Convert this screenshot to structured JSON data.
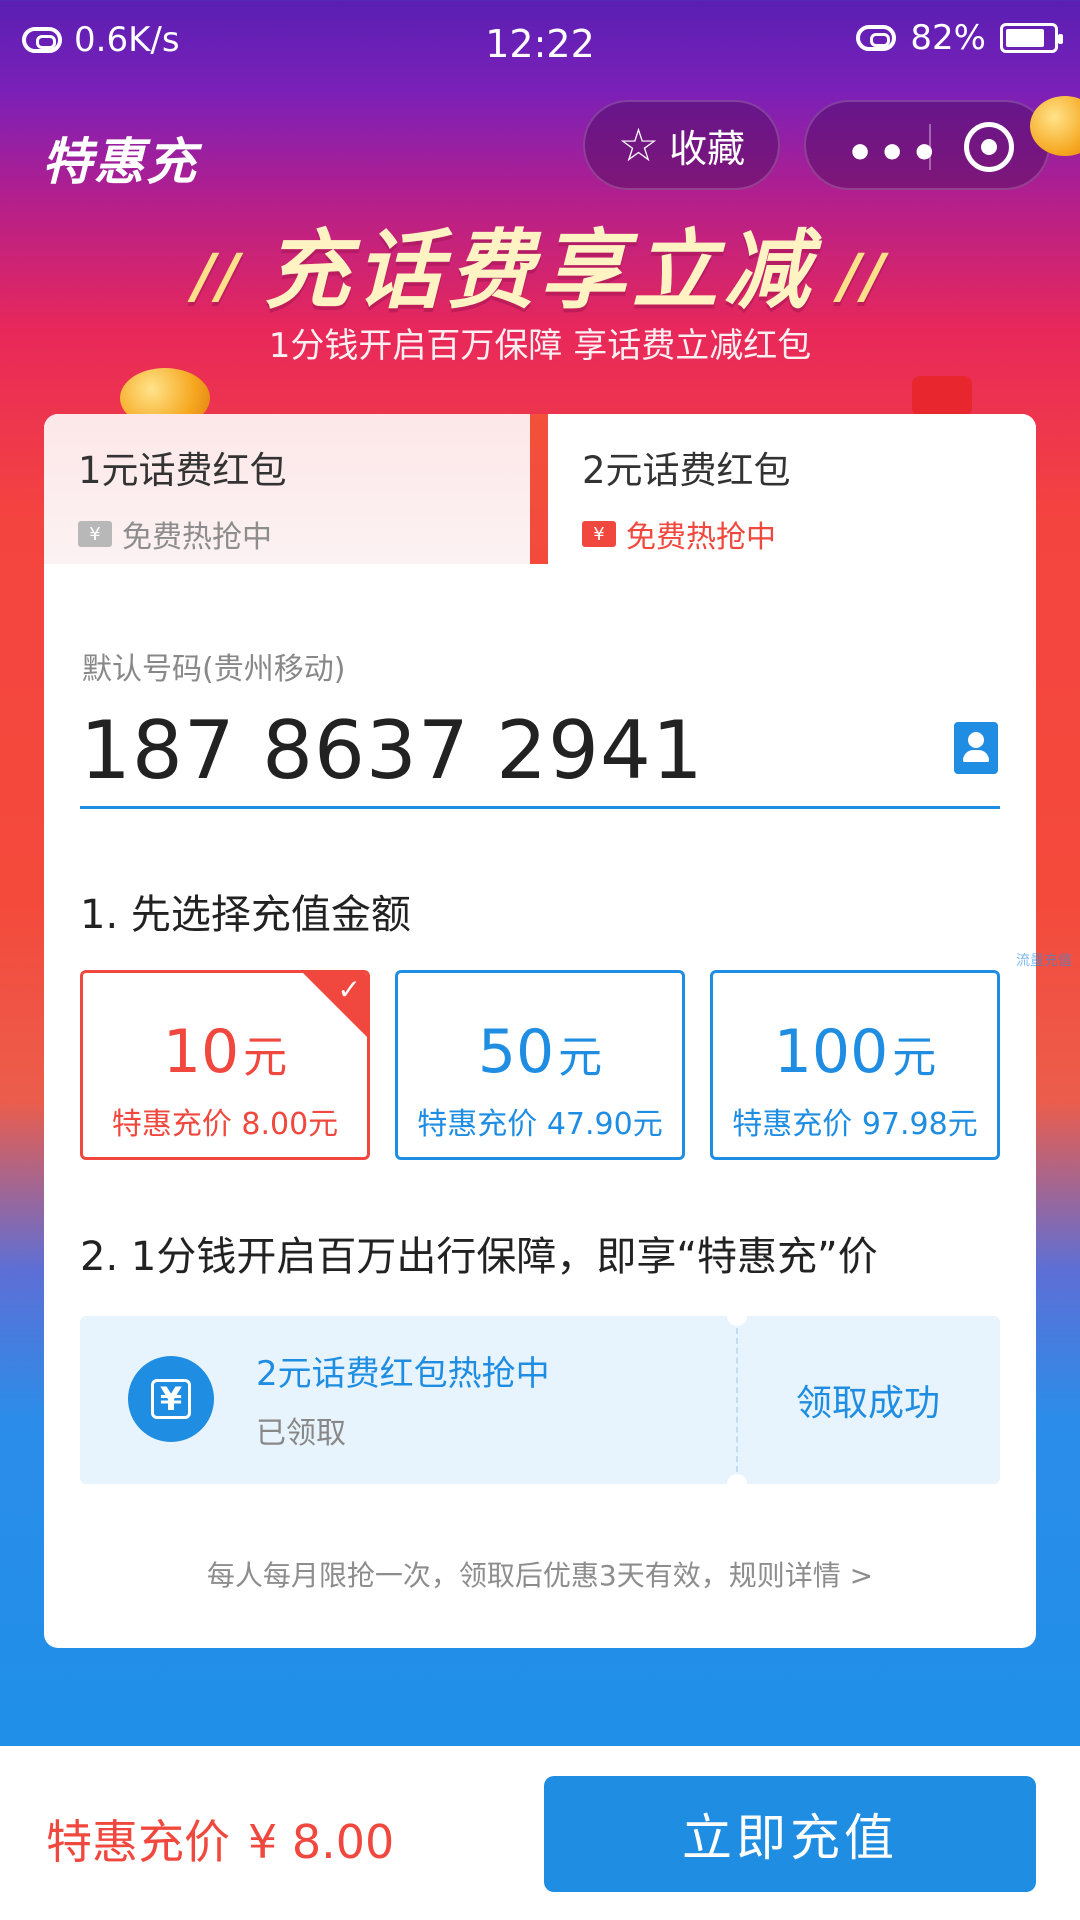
{
  "status_bar": {
    "speed": "0.6K/s",
    "time": "12:22",
    "battery": "82%"
  },
  "header": {
    "brand": "特惠充",
    "favorite_label": "收藏",
    "more_label": "•••"
  },
  "hero": {
    "title": "充话费享立减",
    "subtitle": "1分钱开启百万保障  享话费立减红包"
  },
  "tabs": [
    {
      "title": "1元话费红包",
      "subtitle": "免费热抢中"
    },
    {
      "title": "2元话费红包",
      "subtitle": "免费热抢中"
    }
  ],
  "phone": {
    "label": "默认号码(贵州移动)",
    "number": "187 8637 2941"
  },
  "step1": {
    "title": "1. 先选择充值金额"
  },
  "amounts": [
    {
      "value": "10",
      "unit": "元",
      "price": "特惠充价 8.00元",
      "selected": true
    },
    {
      "value": "50",
      "unit": "元",
      "price": "特惠充价 47.90元",
      "selected": false
    },
    {
      "value": "100",
      "unit": "元",
      "price": "特惠充价 97.98元",
      "selected": false
    }
  ],
  "step2": {
    "title": "2. 1分钱开启百万出行保障，即享“特惠充”价"
  },
  "coupon": {
    "icon_text": "¥",
    "title": "2元话费红包热抢中",
    "status": "已领取",
    "action": "领取成功"
  },
  "rules_note": "每人每月限抢一次，领取后优惠3天有效，规则详情 >",
  "side_text": "流量充值",
  "bottom": {
    "price_label": "特惠充价",
    "price_value": "¥ 8.00",
    "button_label": "立即充值"
  },
  "colors": {
    "accent_blue": "#1e8de2",
    "accent_red": "#f0483e"
  }
}
